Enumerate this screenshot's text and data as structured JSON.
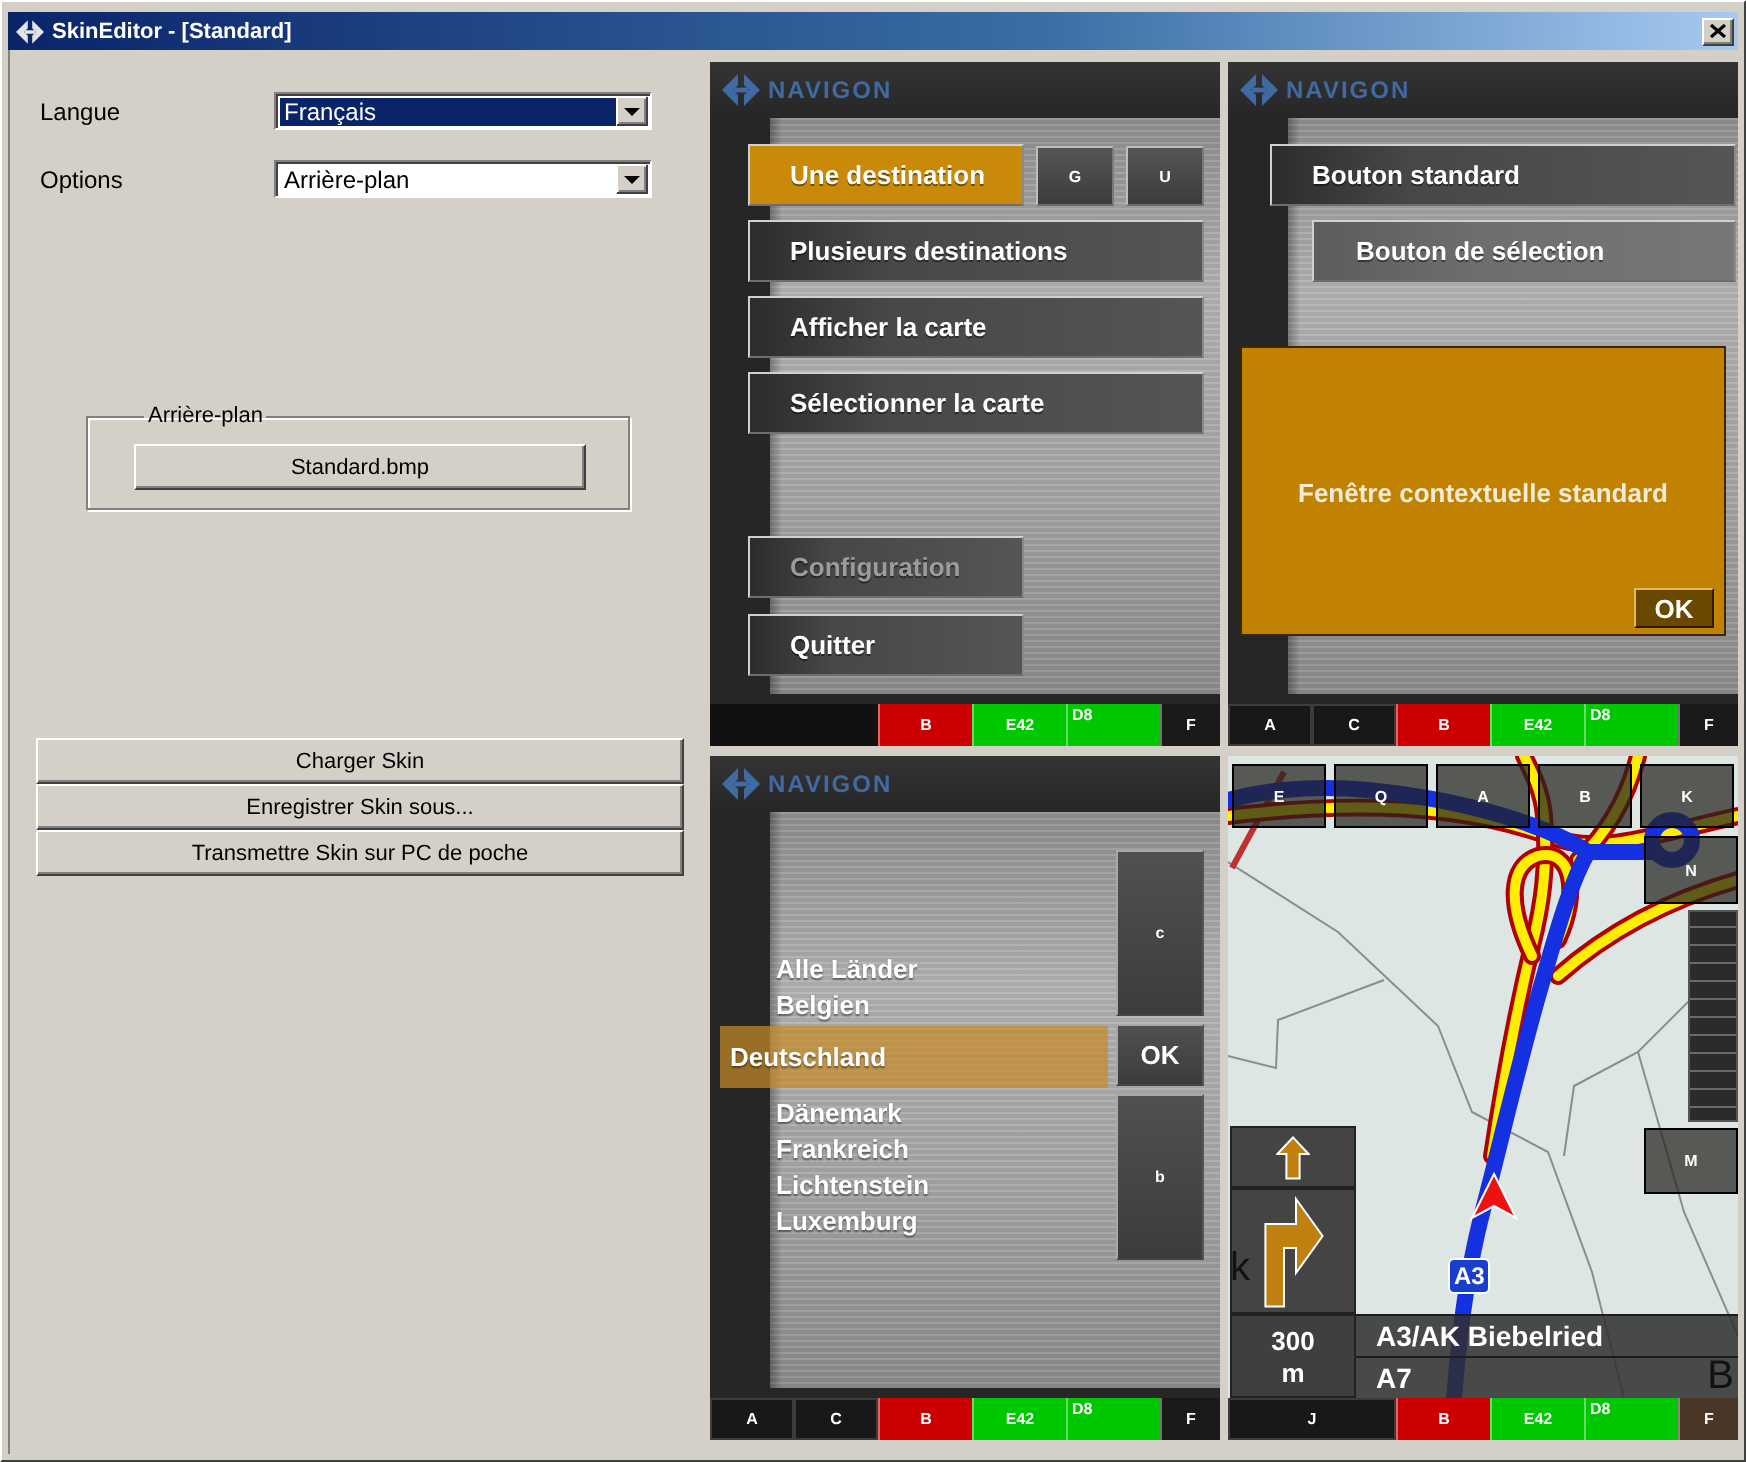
{
  "window": {
    "title": "SkinEditor - [Standard]"
  },
  "settings": [
    {
      "label": "Langue",
      "value": "Français",
      "focused": true
    },
    {
      "label": "Options",
      "value": "Arrière-plan",
      "focused": false
    }
  ],
  "background_group": {
    "title": "Arrière-plan",
    "button": "Standard.bmp"
  },
  "actions": [
    "Charger Skin",
    "Enregistrer Skin sous...",
    "Transmettre Skin sur PC de poche"
  ],
  "previews": [
    {
      "kind": "menu",
      "logo": "NAVIGON",
      "menu_buttons": [
        {
          "label": "Une destination",
          "selected": true,
          "disabled": false
        },
        {
          "label": "Plusieurs destinations",
          "selected": false,
          "disabled": false
        },
        {
          "label": "Afficher la carte",
          "selected": false,
          "disabled": false
        },
        {
          "label": "Sélectionner la carte",
          "selected": false,
          "disabled": false
        }
      ],
      "shortcut_buttons": [
        "G",
        "U"
      ],
      "bottom_buttons": [
        {
          "label": "Configuration",
          "selected": false,
          "disabled": true
        },
        {
          "label": "Quitter",
          "selected": false,
          "disabled": false
        }
      ],
      "status_bar": {
        "right": [
          {
            "label": "B",
            "color": "#cc0000",
            "kind": "center"
          },
          {
            "label": "E42",
            "color": "#00c800",
            "kind": "center"
          },
          {
            "label": "D8",
            "color": "#00c800",
            "kind": "corner"
          },
          {
            "label": "F",
            "color": "#1a1a1a",
            "kind": "center"
          }
        ]
      }
    },
    {
      "kind": "buttons",
      "logo": "NAVIGON",
      "buttons": [
        {
          "label": "Bouton standard",
          "kind": "standard"
        },
        {
          "label": "Bouton de sélection",
          "kind": "selection"
        }
      ],
      "popup": {
        "message": "Fenêtre contextuelle standard",
        "button": "OK"
      },
      "status_bar": {
        "left": [
          "A",
          "C"
        ],
        "right": [
          {
            "label": "B",
            "color": "#cc0000",
            "kind": "center"
          },
          {
            "label": "E42",
            "color": "#00c800",
            "kind": "center"
          },
          {
            "label": "D8",
            "color": "#00c800",
            "kind": "corner"
          },
          {
            "label": "F",
            "color": "#1a1a1a",
            "kind": "center"
          }
        ]
      }
    },
    {
      "kind": "list",
      "logo": "NAVIGON",
      "items": [
        {
          "label": "Alle Länder",
          "selected": false
        },
        {
          "label": "Belgien",
          "selected": false
        },
        {
          "label": "Deutschland",
          "selected": true
        },
        {
          "label": "Dänemark",
          "selected": false
        },
        {
          "label": "Frankreich",
          "selected": false
        },
        {
          "label": "Lichtenstein",
          "selected": false
        },
        {
          "label": "Luxemburg",
          "selected": false
        }
      ],
      "controls": [
        {
          "label": "c",
          "kind": "scroll"
        },
        {
          "label": "OK",
          "kind": "confirm"
        },
        {
          "label": "b",
          "kind": "scroll"
        }
      ],
      "status_bar": {
        "left": [
          "A",
          "C"
        ],
        "right": [
          {
            "label": "B",
            "color": "#cc0000",
            "kind": "center"
          },
          {
            "label": "E42",
            "color": "#00c800",
            "kind": "center"
          },
          {
            "label": "D8",
            "color": "#00c800",
            "kind": "corner"
          },
          {
            "label": "F",
            "color": "#1a1a1a",
            "kind": "center"
          }
        ]
      }
    },
    {
      "kind": "map",
      "top_buttons": [
        "E",
        "Q",
        "A",
        "B",
        "K"
      ],
      "side_buttons": [
        "N",
        "M"
      ],
      "road_shield": "A3",
      "maneuver": {
        "distance": "300",
        "unit": "m",
        "street": "A3/AK Biebelried",
        "next_street": "A7"
      },
      "map_letters": [
        "k",
        "B"
      ],
      "status_bar": {
        "left": [
          "J"
        ],
        "right": [
          {
            "label": "B",
            "color": "#cc0000",
            "kind": "center"
          },
          {
            "label": "E42",
            "color": "#00c800",
            "kind": "center"
          },
          {
            "label": "D8",
            "color": "#00c800",
            "kind": "corner"
          },
          {
            "label": "F",
            "color": "#4a3626",
            "kind": "center"
          }
        ]
      }
    }
  ]
}
